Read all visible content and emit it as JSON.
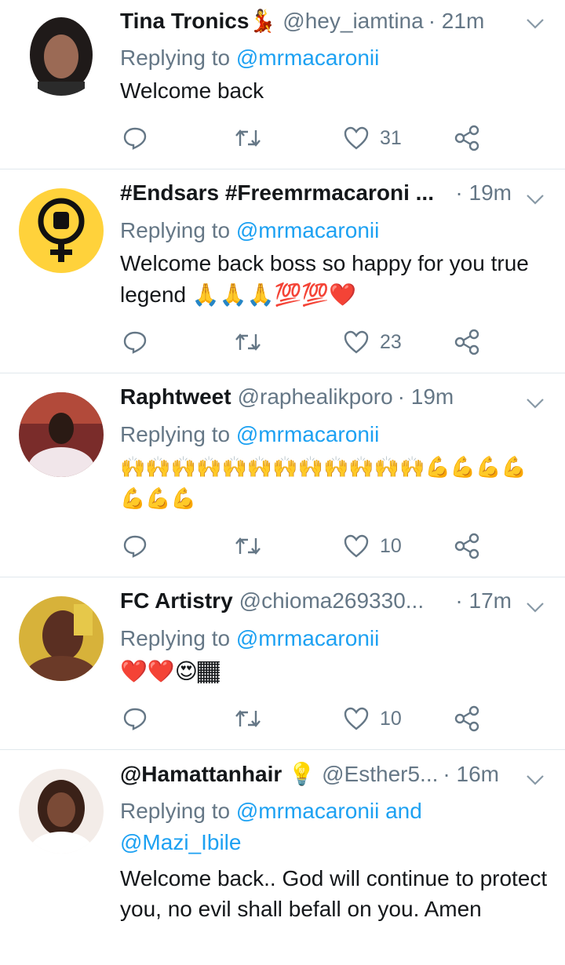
{
  "tweets": [
    {
      "name": "Tina Tronics",
      "name_emoji": "💃",
      "handle": "@hey_iamtina",
      "time": "· 21m",
      "replying_prefix": "Replying to",
      "replying_to": "@mrmacaronii",
      "replying_more": "",
      "text": "Welcome back",
      "likes": "31",
      "avatar_bg": "#2b2b2b"
    },
    {
      "name": "#Endsars #Freemrmacaroni ...",
      "name_emoji": "",
      "handle": "",
      "time": "· 19m",
      "replying_prefix": "Replying to",
      "replying_to": "@mrmacaronii",
      "replying_more": "",
      "text": "Welcome back boss so happy for you true legend 🙏🙏🙏💯💯❤️",
      "likes": "23",
      "avatar_bg": "#ffd23b"
    },
    {
      "name": "Raphtweet",
      "name_emoji": "",
      "handle": "@raphealikporo",
      "time": "· 19m",
      "replying_prefix": "Replying to",
      "replying_to": "@mrmacaronii",
      "replying_more": "",
      "text": "🙌🙌🙌🙌🙌🙌🙌🙌🙌🙌🙌🙌💪💪💪💪💪💪💪",
      "likes": "10",
      "avatar_bg": "#a1473a"
    },
    {
      "name": "FC Artistry",
      "name_emoji": "",
      "handle": "@chioma269330...",
      "time": "· 17m",
      "replying_prefix": "Replying to",
      "replying_to": "@mrmacaronii",
      "replying_more": "",
      "text": "❤️❤️😍🏾",
      "likes": "10",
      "avatar_bg": "#5a2f22"
    },
    {
      "name": "@Hamattanhair",
      "name_emoji": "💡",
      "handle": "@Esther5...",
      "time": "· 16m",
      "replying_prefix": "Replying to",
      "replying_to": "@mrmacaronii and",
      "replying_more": "@Mazi_Ibile",
      "text": "Welcome back.. God will continue to protect you, no evil shall befall on you. Amen",
      "likes": "",
      "avatar_bg": "#e8d6cf"
    }
  ],
  "colors": {
    "accent": "#1da1f2",
    "muted": "#657786",
    "divider": "#e1e8ed"
  },
  "icons": [
    "reply-icon",
    "retweet-icon",
    "like-icon",
    "share-icon",
    "chevron-down-icon"
  ]
}
